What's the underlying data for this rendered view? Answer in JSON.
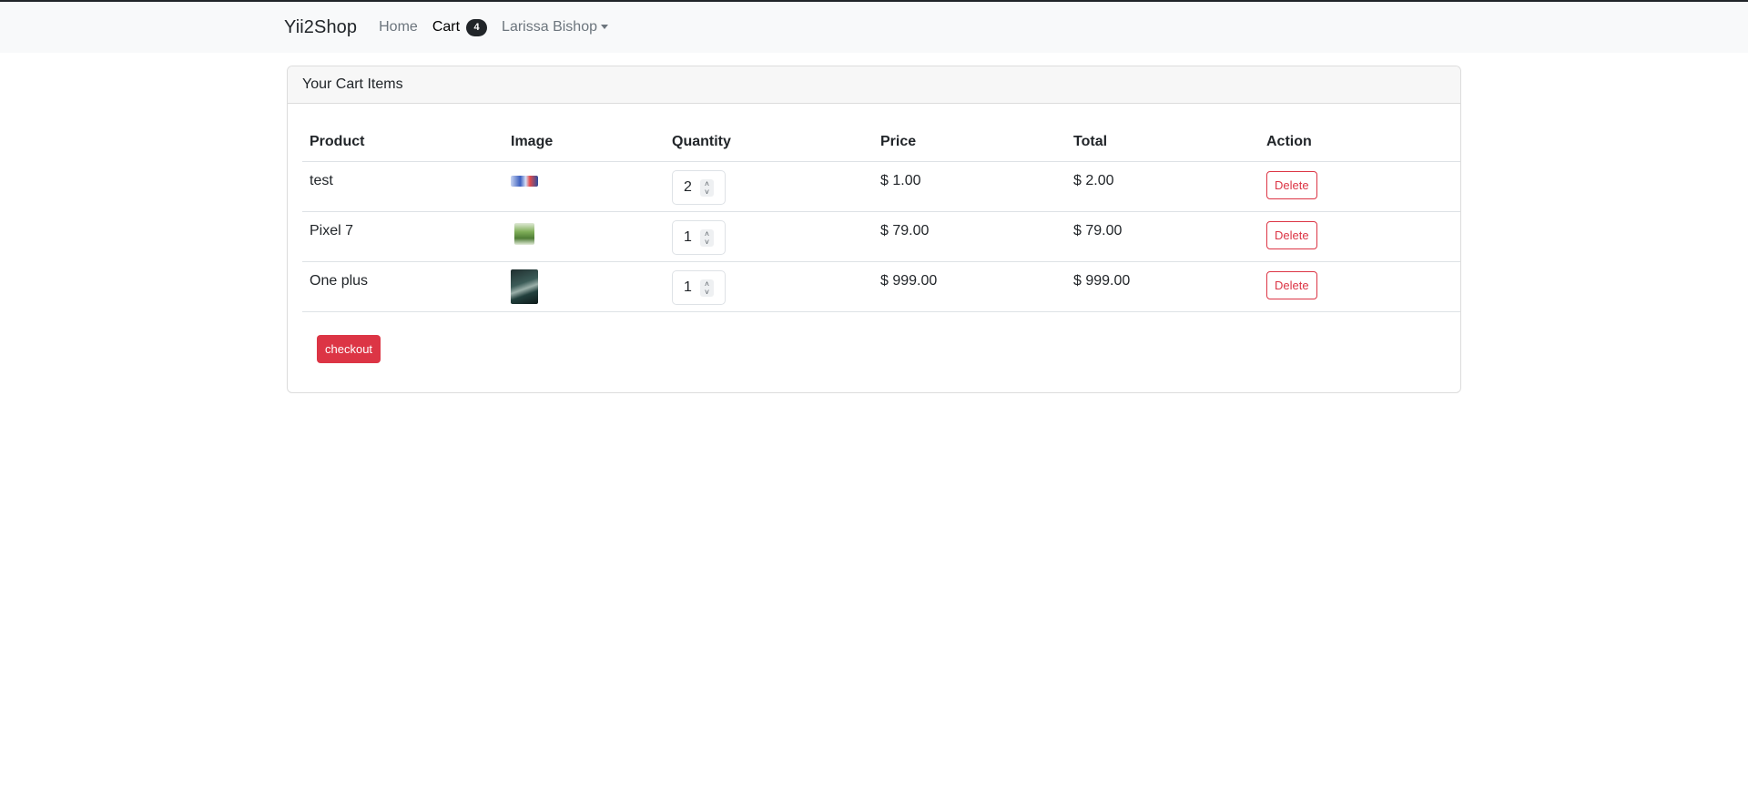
{
  "navbar": {
    "brand": "Yii2Shop",
    "home_label": "Home",
    "cart_label": "Cart",
    "cart_count": "4",
    "user_label": "Larissa Bishop"
  },
  "card": {
    "header": "Your Cart Items"
  },
  "table": {
    "headers": [
      "Product",
      "Image",
      "Quantity",
      "Price",
      "Total",
      "Action"
    ],
    "rows": [
      {
        "product": "test",
        "image_icon": "product-thumbnail-icon",
        "quantity": "2",
        "price": "$ 1.00",
        "total": "$ 2.00",
        "action": "Delete"
      },
      {
        "product": "Pixel 7",
        "image_icon": "product-thumbnail-icon",
        "quantity": "1",
        "price": "$ 79.00",
        "total": "$ 79.00",
        "action": "Delete"
      },
      {
        "product": "One plus",
        "image_icon": "product-thumbnail-icon",
        "quantity": "1",
        "price": "$ 999.00",
        "total": "$ 999.00",
        "action": "Delete"
      }
    ]
  },
  "checkout_label": "checkout",
  "colors": {
    "danger": "#dc3545",
    "navbar_bg": "#f8f9fa",
    "badge_bg": "#212529"
  }
}
